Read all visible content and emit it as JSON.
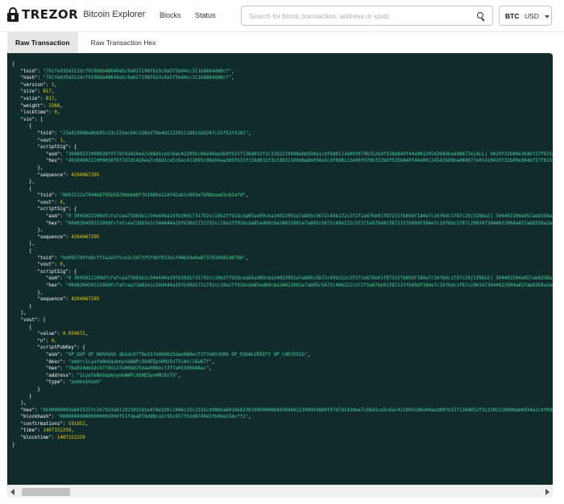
{
  "header": {
    "logo_text": "TREZOR",
    "logo_sub": "Bitcoin Explorer",
    "nav": {
      "blocks": "Blocks",
      "status": "Status"
    },
    "search_placeholder": "Search for block, transaction, address or xpub",
    "currency": {
      "btc": "BTC",
      "usd": "USD"
    }
  },
  "tabs": {
    "raw": "Raw Transaction",
    "raw_hex": "Raw Transaction Hex"
  },
  "colors": {
    "panel_bg": "#0f2b2a",
    "key": "#ffffff",
    "string": "#45d3a2",
    "number": "#f5d000"
  },
  "tx": {
    "txid": "791fe035d312dcf9196bb48649a5c9a027198f623c0a5f5bd4cc311b8864dd0cf",
    "hash": "791fe035d312dcf9196bb48649a5c9a027198f623c0a5f5bd4cc311b8864dd0cf",
    "version": 1,
    "size": 817,
    "vsize": 817,
    "weight": 3268,
    "locktime": 0,
    "vin": [
      {
        "txid": "23e81960ba8bb95c33c233ec84c126e378e4d11239211881da9247c25f52f4161",
        "vout": 1,
        "asm": "30460221009038f9f7d7d1426ea7c66d1ce5c6ac421095c86e94aa3b9fb15f136d032f3c31022100d8abb034a1cdf0d8113e00f079b352bdf526b849f44a00124542689bad48877e[ALL] 0429f32b89e364bf27f815e110ecace074",
        "hex": "4930460221009038f9f7d7d1426ea7c66d1ce5c6ac421095c86e94aa3b9fb15f136d032f3c31022100d8abb034a1cdf0d8113e00f079b352bdf526b849f44a00124542689bad48877e01410429f32b89e364bf27f815e110ecace074",
        "sequence": 4294967295
      },
      {
        "txid": "8602122a7044b8795b5829bbb48ffb1960a124f42ab1c003e7b9bbaad3cb2afd",
        "vout": 0,
        "asm": "0 3045022100dfcfafcea73d83e1c54d444a19fb30d1731792cc19e2ff92dcda65ad09cba34022001e7a805c5672c49b222c5f2f1e67bb01f87215fb69df184e7c16f6dc1f87c29[SINGLE] 304402204a657ab8358a2edb8fd5ed8a45",
        "hex": "00483045022100dfcfafcea73d83e1c54d444a19fb30d1731792cc19e2ff92dcda65ad09cba34022001e7a805c5672c49b222c5f2f1e67bb01f87215fb69df184e7c16f6dc1f87c2903473044022004a657ab8358a2edb8fd5ed8a45",
        "sequence": 4294967295
      },
      {
        "txid": "bd992789fd8cff1a2e5f5ce2c3473f5f0df933e1f44b3de6a8737630b82d0786",
        "vout": 0,
        "asm": "0 3045022100dfcfafcea73d83e1c54d444a19fb30d1731792cc19e2ff92dcda65ad09cba34022001e7a805c5672c49b222c5f2f1e67bb01f87215fb69df184e7c16f6dc1f87c29[SINGLE] 304402204a657ab8358a2edb8fd5ed8a45fb",
        "hex": "00483045022100dfcfafcea73d83e1c54d444a19fb30d1731792cc19e2ff92dcda65ad09cba34022001e7a805c5672c49b222c5f2f1e67bb01f87215fb69df184e7c16f6dc1f87c2903473044022004a657ab8358a2edb8fd5ed8a45fb",
        "sequence": 4294967295
      }
    ],
    "vout": [
      {
        "value": 0.059672,
        "n": 0,
        "asm": "OP_DUP OP_HASH160 db1dc97f9e137e066825dae080ecf3f7e053906 OP_EQUALVERIFY OP_CHECKSIG",
        "desc": "addr(1Lyafe8mSqubnynbAWPcXbHE5pnHMzEnT3)#zcl6w67f",
        "hex": "76a914db1dc97f9e137e066825dae080ecf3f7e05390688ac",
        "address": "1Lyafe8mSqubnynbAWPcXbHE5pnHMzEnT3",
        "type": "pubkeyhash"
      }
    ],
    "hex": "0100000003e841525fc24792da811923912d1e478e326c1846c33c2335cb98bba6019e823010000008b493046022100903889f97d7d1426ea7c66d1ce5c6ac421095c86e94aa3b9fb15f136d032f3c31022100d8abb034a1cdf0d8113e00f",
    "blockhash": "000000000000000001004f51fdea079dd8ca2c95c077fb2d874941fb9de234cff1",
    "confirmations": 591852,
    "time": 1407152259,
    "blocktime": 1407152259
  }
}
